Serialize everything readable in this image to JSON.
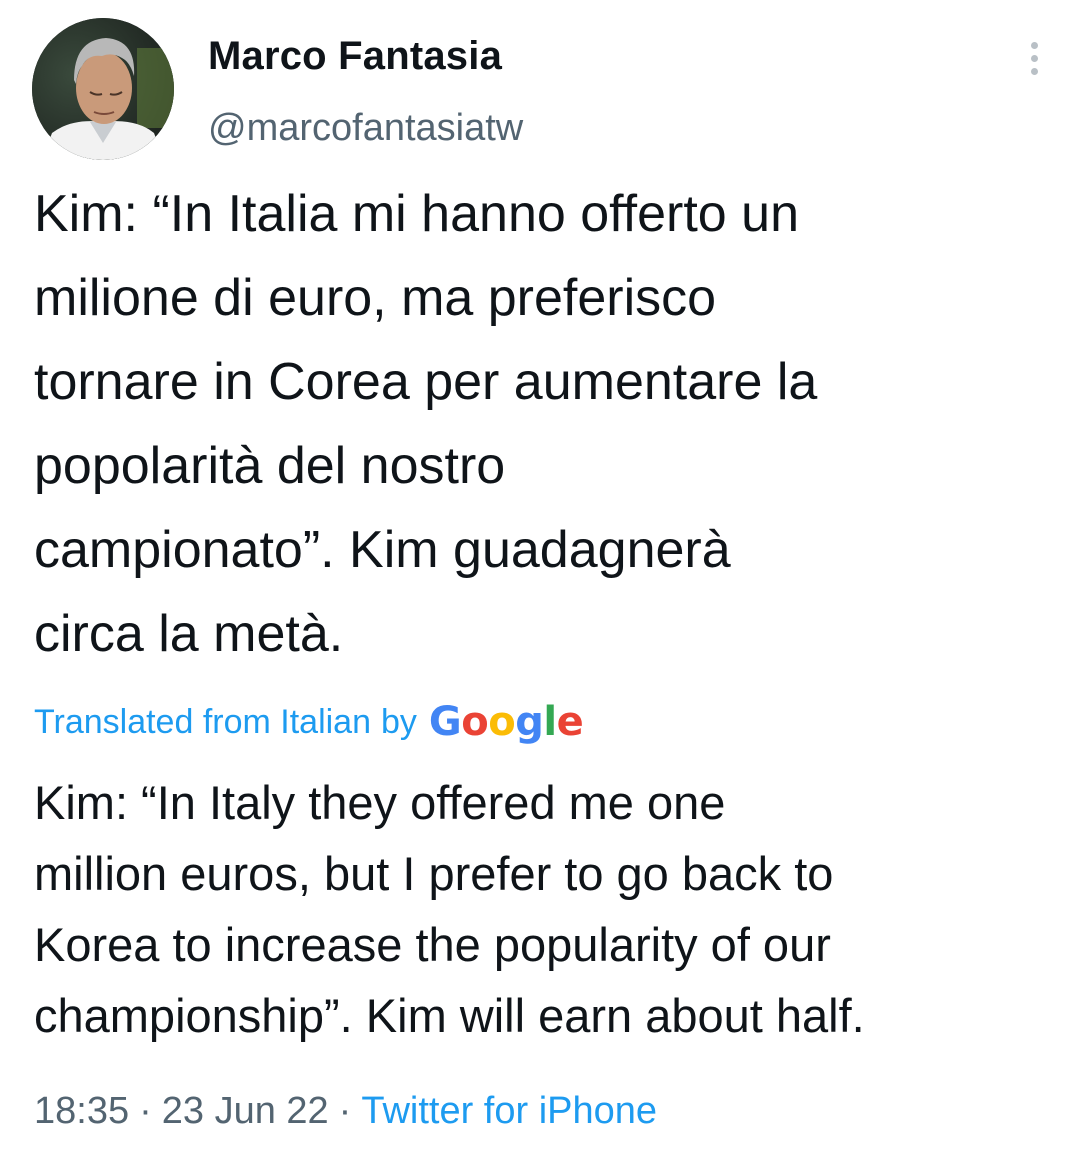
{
  "author": {
    "display_name": "Marco Fantasia",
    "handle": "@marcofantasiatw"
  },
  "tweet": {
    "original_text": "Kim: “In Italia mi hanno offerto un\nmilione di euro, ma preferisco\ntornare in Corea per aumentare la\npopolarità del nostro\ncampionato”. Kim guadagnerà\ncirca la metà.",
    "translated_label": "Translated from Italian",
    "translated_by": "by",
    "translation_provider": "Google",
    "translation_text": "Kim: “In Italy they offered me one\nmillion euros, but I prefer to go back to\nKorea to increase the popularity of our\nchampionship”. Kim will earn about half.",
    "time": "18:35",
    "date": "23 Jun 22",
    "source": "Twitter for iPhone",
    "separator": "·"
  },
  "icons": {
    "more": "more-vertical-icon"
  },
  "colors": {
    "link": "#1d9bf0",
    "secondary_text": "#536471",
    "primary_text": "#0f1419"
  }
}
